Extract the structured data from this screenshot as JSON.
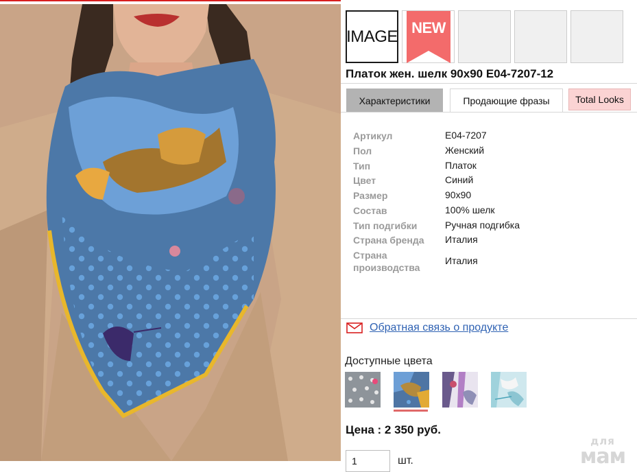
{
  "product": {
    "title": "Платок жен. шелк 90x90 E04-7207-12"
  },
  "thumbnails": [
    {
      "label": "IMAGE"
    },
    {
      "label": "NEW"
    },
    {
      "label": ""
    },
    {
      "label": ""
    },
    {
      "label": ""
    }
  ],
  "tabs": [
    {
      "label": "Характеристики",
      "active": true
    },
    {
      "label": "Продающие фразы",
      "active": false
    },
    {
      "label": "Total Looks",
      "active": false
    }
  ],
  "specs": [
    {
      "label": "Артикул",
      "value": "E04-7207"
    },
    {
      "label": "Пол",
      "value": "Женский"
    },
    {
      "label": "Тип",
      "value": "Платок"
    },
    {
      "label": "Цвет",
      "value": "Синий"
    },
    {
      "label": "Размер",
      "value": "90x90"
    },
    {
      "label": "Состав",
      "value": "100% шелк"
    },
    {
      "label": "Тип подгибки",
      "value": "Ручная подгибка"
    },
    {
      "label": "Страна бренда",
      "value": "Италия"
    },
    {
      "label": "Страна производства",
      "value": "Италия"
    }
  ],
  "feedback": {
    "icon": "mail-icon",
    "link_text": "Обратная связь о продукте"
  },
  "colors": {
    "label": "Доступные цвета",
    "selected_index": 1
  },
  "price": {
    "text": "Цена : 2 350 руб."
  },
  "quantity": {
    "value": "1",
    "unit": "шт."
  },
  "watermark": {
    "line1": "для",
    "line2": "мам"
  },
  "theme": {
    "accent_red": "#d81e1e",
    "link_blue": "#2f62b3",
    "tab_active_bg": "#b3b3b3",
    "tab_pink_bg": "#fbd3d3",
    "new_badge": "#f36b6b"
  }
}
